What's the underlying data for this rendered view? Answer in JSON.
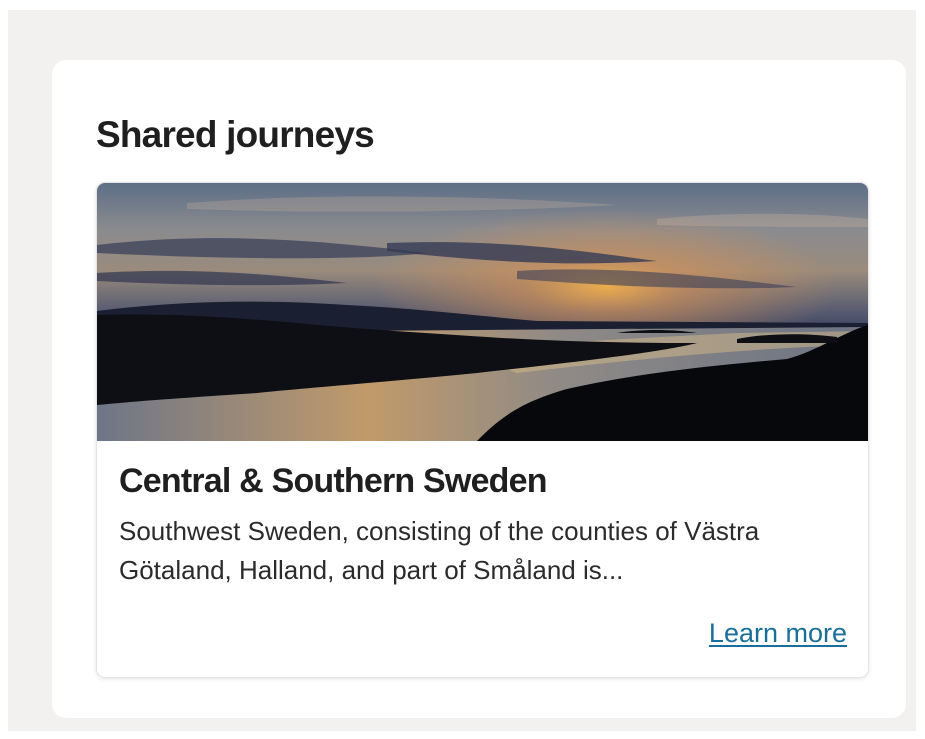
{
  "section": {
    "title": "Shared journeys"
  },
  "card": {
    "image_alt": "Sunset over a calm waterway with dark silhouetted shoreline",
    "title": "Central & Southern Sweden",
    "description": "Southwest Sweden, consisting of the counties of Västra Götaland, Halland, and part of Småland is...",
    "link_label": "Learn more"
  },
  "colors": {
    "page_background": "#f3f1ef",
    "panel_background": "#ffffff",
    "title_text": "#1f1f1f",
    "link": "#1a6f9a"
  }
}
